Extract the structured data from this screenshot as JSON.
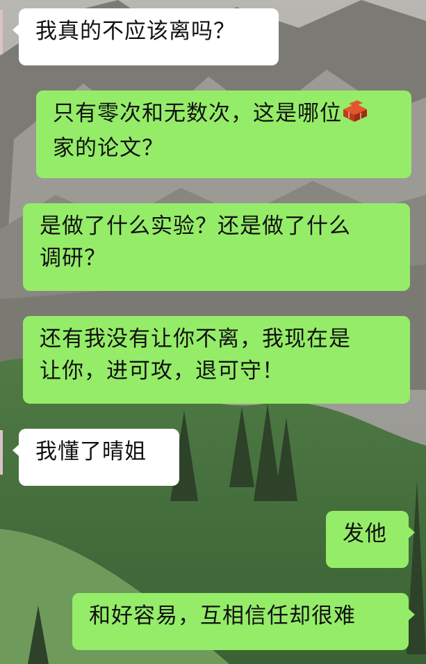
{
  "messages": [
    {
      "side": "received",
      "text": "我真的不应该离吗？"
    },
    {
      "side": "sent",
      "text": "只有零次和无数次，这是哪位",
      "line2": "家的论文？",
      "icon": "brick-icon"
    },
    {
      "side": "sent",
      "text": "是做了什么实验？还是做了什么",
      "line2": "调研？"
    },
    {
      "side": "sent",
      "text": "还有我没有让你不离，我现在是",
      "line2": "让你，进可攻，退可守！"
    },
    {
      "side": "received",
      "text": "我懂了晴姐"
    },
    {
      "side": "sent",
      "text": "发他"
    },
    {
      "side": "sent",
      "text": "和好容易，互相信任却很难"
    }
  ],
  "colors": {
    "sent_bubble": "#95ec69",
    "received_bubble": "#ffffff"
  }
}
